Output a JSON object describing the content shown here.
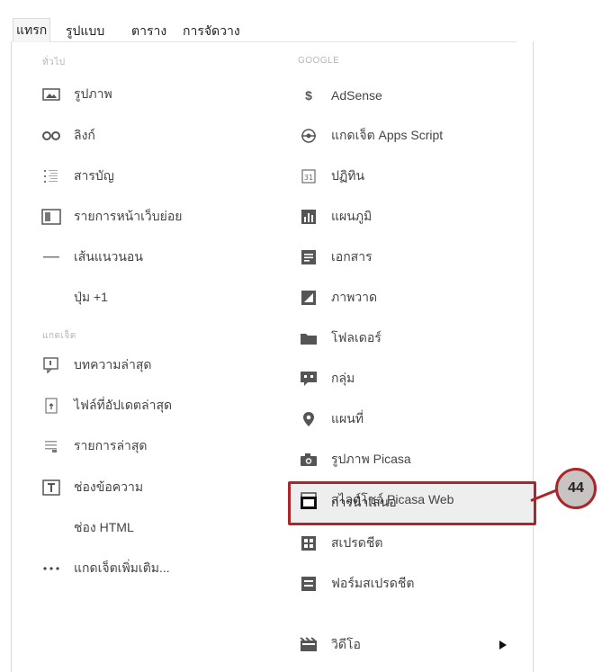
{
  "menubar": {
    "tabs": [
      "แทรก",
      "รูปแบบ",
      "ตาราง",
      "การจัดวาง"
    ]
  },
  "left": {
    "section1": "ทั่วไป",
    "items1": [
      {
        "label": "รูปภาพ",
        "icon": "image-icon"
      },
      {
        "label": "ลิงก์",
        "icon": "link-icon"
      },
      {
        "label": "สารบัญ",
        "icon": "table-of-contents-icon"
      },
      {
        "label": "รายการหน้าเว็บย่อย",
        "icon": "subpage-listing-icon"
      },
      {
        "label": "เส้นแนวนอน",
        "icon": "horizontal-line-icon"
      },
      {
        "label": "ปุ่ม +1",
        "icon": ""
      }
    ],
    "section2": "แกดเจ็ต",
    "items2": [
      {
        "label": "บทความล่าสุด",
        "icon": "recent-posts-icon"
      },
      {
        "label": "ไฟล์ที่อัปเดตล่าสุด",
        "icon": "recent-files-icon"
      },
      {
        "label": "รายการล่าสุด",
        "icon": "recent-list-icon"
      },
      {
        "label": "ช่องข้อความ",
        "icon": "text-box-icon"
      },
      {
        "label": "ช่อง HTML",
        "icon": ""
      },
      {
        "label": "แกดเจ็ตเพิ่มเติม...",
        "icon": "more-icon"
      }
    ]
  },
  "right": {
    "section": "GOOGLE",
    "items": [
      {
        "label": "AdSense",
        "icon": "dollar-icon"
      },
      {
        "label": "แกดเจ็ต Apps Script",
        "icon": "apps-script-icon"
      },
      {
        "label": "ปฏิทิน",
        "icon": "calendar-icon"
      },
      {
        "label": "แผนภูมิ",
        "icon": "chart-icon"
      },
      {
        "label": "เอกสาร",
        "icon": "document-icon"
      },
      {
        "label": "ภาพวาด",
        "icon": "drawing-icon"
      },
      {
        "label": "โฟลเดอร์",
        "icon": "folder-icon"
      },
      {
        "label": "กลุ่ม",
        "icon": "group-icon"
      },
      {
        "label": "แผนที่",
        "icon": "map-pin-icon"
      },
      {
        "label": "รูปภาพ Picasa",
        "icon": "camera-icon"
      },
      {
        "label": "สไลด์โชว์ Picasa Web",
        "icon": "slideshow-icon"
      },
      {
        "label": "การนำเสนอ",
        "icon": "presentation-icon"
      },
      {
        "label": "สเปรดชีต",
        "icon": "spreadsheet-icon"
      },
      {
        "label": "ฟอร์มสเปรดชีต",
        "icon": "form-icon"
      },
      {
        "label": "วิดีโอ",
        "icon": "video-icon"
      }
    ]
  },
  "callout": {
    "number": "44"
  },
  "colors": {
    "highlight_border": "#a9262a",
    "icon_dark": "#555555"
  }
}
